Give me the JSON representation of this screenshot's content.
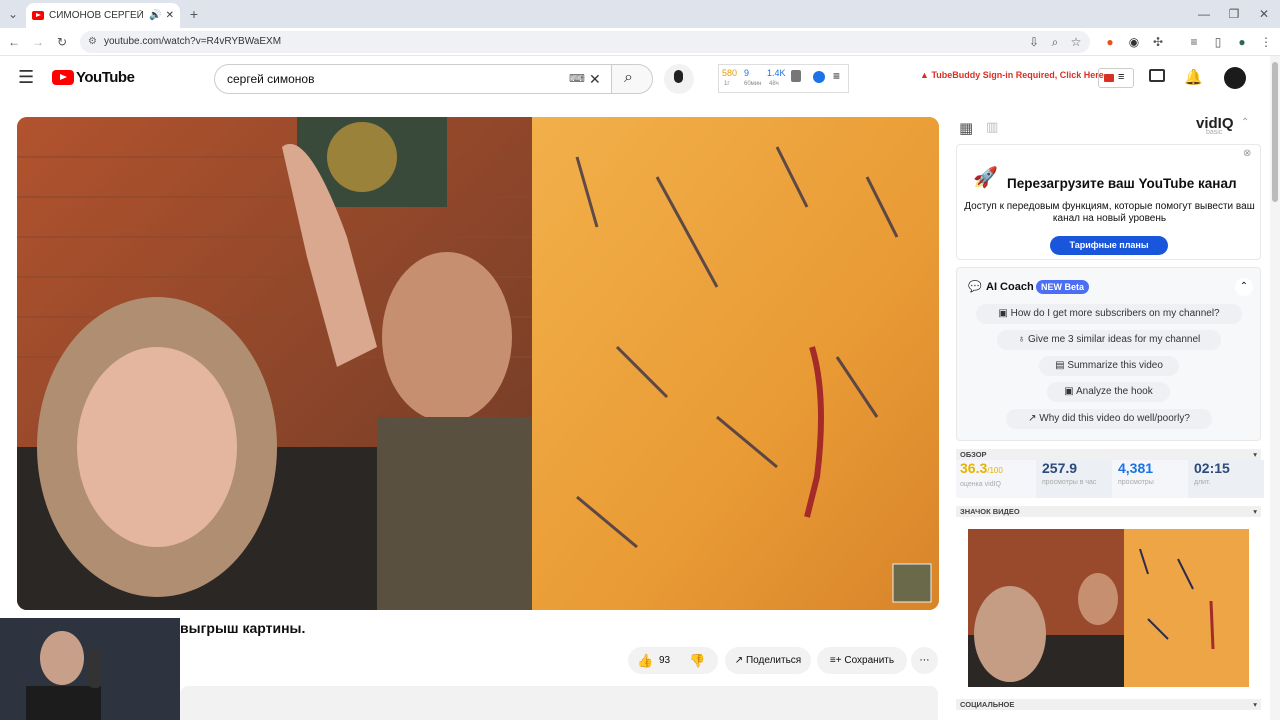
{
  "browser": {
    "tab_title": "СИМОНОВ СЕРГЕЙ - розы",
    "url": "youtube.com/watch?v=R4vRYBWaEXM"
  },
  "youtube": {
    "logo_text": "YouTube",
    "search_value": "сергей симонов",
    "tubebuddy_stats": {
      "a": "580",
      "a_sub": "1г",
      "b": "9",
      "b_sub": "60мин",
      "c": "1.4K",
      "c_sub": "48ч"
    },
    "tubebuddy_warning": "TubeBuddy Sign-in Required, Click Here",
    "video_title": "выгрыш картины.",
    "likes": "93",
    "share_label": "Поделиться",
    "save_label": "Сохранить"
  },
  "vidiq": {
    "logo": "vidIQ",
    "logo_sub": "basic",
    "promo_title": "Перезагрузите ваш YouTube канал",
    "promo_text": "Доступ к передовым функциям, которые помогут вывести ваш канал на новый уровень",
    "promo_button": "Тарифные планы",
    "coach_title": "AI Coach",
    "coach_badge": "NEW Beta",
    "coach_questions": [
      "How do I get more subscribers on my channel?",
      "Give me 3 similar ideas for my channel",
      "Summarize this video",
      "Analyze the hook",
      "Why did this video do well/poorly?"
    ],
    "overview_label": "ОБЗОР",
    "score": "36.3",
    "score_suffix": "/100",
    "score_label": "оценка vidIQ",
    "vph": "257.9",
    "vph_label": "просмотры в час",
    "views": "4,381",
    "views_label": "просмотры",
    "length": "02:15",
    "length_label": "длит.",
    "thumb_label": "ЗНАЧОК ВИДЕО",
    "social_label": "СОЦИАЛЬНОЕ"
  },
  "colors": {
    "yt_red": "#ff0000",
    "vidiq_blue": "#1a73e8",
    "promo_btn": "#1a56db",
    "badge": "#4c6ef5",
    "tubebuddy_red": "#d93025"
  }
}
